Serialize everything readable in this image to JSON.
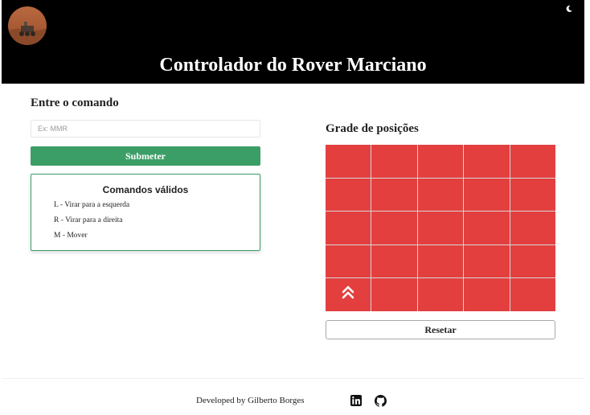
{
  "header": {
    "title": "Controlador do Rover Marciano",
    "avatar_icon": "mars-rover-avatar",
    "theme_toggle_icon": "moon-icon",
    "bg_color": "#000000"
  },
  "command": {
    "title": "Entre o comando",
    "input_placeholder": "Ex: MMR",
    "input_value": "",
    "submit_label": "Submeter",
    "submit_color": "#3c9e67"
  },
  "valid_commands": {
    "title": "Comandos válidos",
    "items": [
      "L - Virar para a esquerda",
      "R - Virar para a direita",
      "M - Mover"
    ]
  },
  "grid": {
    "title": "Grade de posições",
    "rows": 5,
    "cols": 5,
    "cell_color": "#e33f3f",
    "rover": {
      "row": 5,
      "col": 1,
      "heading": "N",
      "icon": "double-chevron-up-icon"
    },
    "reset_label": "Resetar"
  },
  "footer": {
    "credit": "Developed by Gilberto Borges",
    "icons": [
      "linkedin-icon",
      "github-icon"
    ]
  }
}
